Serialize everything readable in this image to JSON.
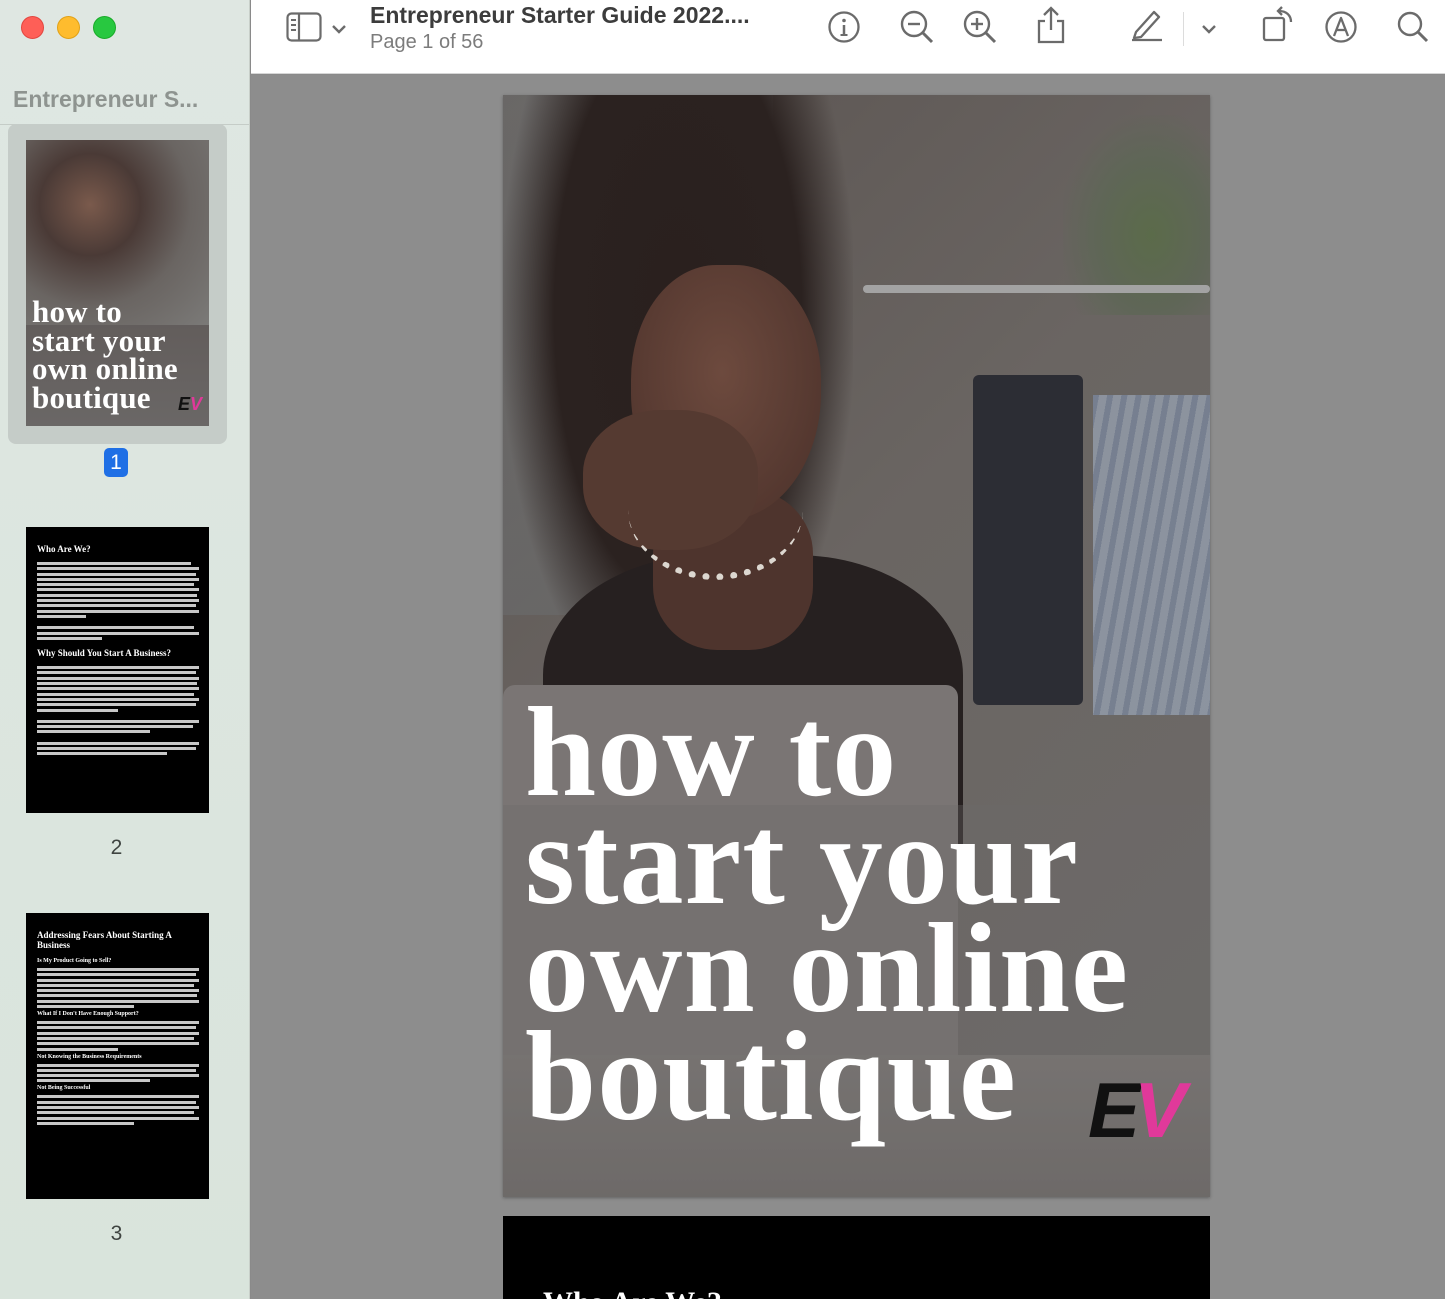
{
  "window": {
    "title": "Entrepreneur Starter Guide 2022....",
    "subtitle": "Page 1 of 56"
  },
  "sidebar": {
    "title": "Entrepreneur S...",
    "thumbnails": [
      {
        "page": "1",
        "lines": [
          "how to",
          "start your",
          "own online",
          "boutique"
        ],
        "logo_a": "E",
        "logo_b": "V"
      },
      {
        "page": "2",
        "heading1": "Who Are We?",
        "heading2": "Why Should You Start A Business?"
      },
      {
        "page": "3",
        "heading1": "Addressing Fears About Starting A Business",
        "sub1": "Is My Product Going to Sell?",
        "sub2": "What If I Don't Have Enough Support?",
        "sub3": "Not Knowing the Business Requirements",
        "sub4": "Not Being Successful"
      }
    ]
  },
  "toolbar": {
    "icons": [
      "sidebar-icon",
      "chevron-down-icon",
      "info-icon",
      "zoom-out-icon",
      "zoom-in-icon",
      "share-icon",
      "markup-pen-icon",
      "chevron-down-icon",
      "rotate-icon",
      "annotate-icon",
      "search-icon"
    ]
  },
  "document": {
    "page1": {
      "line1": "how to",
      "line2": "start your",
      "line3": "own online",
      "line4": "boutique",
      "logo_a": "E",
      "logo_b": "V"
    },
    "page2": {
      "heading": "Who Are We?"
    }
  },
  "colors": {
    "accent": "#1f6fe5",
    "logo_pink": "#e0399a"
  }
}
